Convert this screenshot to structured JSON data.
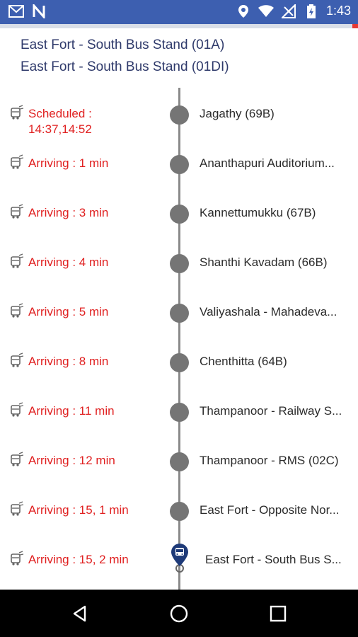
{
  "statusbar": {
    "time": "1:43",
    "colors": {
      "background": "#3d5fb0",
      "foreground": "#ffffff"
    },
    "icons": [
      "gmail-icon",
      "n-app-icon",
      "location-icon",
      "wifi-icon",
      "signal-icon",
      "battery-icon"
    ]
  },
  "header": {
    "route_line_1": "East Fort - South Bus Stand (01A)",
    "route_line_2": "East Fort - South Bus Stand (01DI)"
  },
  "stops": [
    {
      "status": "Scheduled :\n14:37,14:52",
      "name": "Jagathy (69B)"
    },
    {
      "status": "Arriving : 1 min",
      "name": "Ananthapuri Auditorium..."
    },
    {
      "status": "Arriving : 3 min",
      "name": "Kannettumukku (67B)"
    },
    {
      "status": "Arriving : 4 min",
      "name": "Shanthi Kavadam (66B)"
    },
    {
      "status": "Arriving : 5 min",
      "name": "Valiyashala - Mahadeva..."
    },
    {
      "status": "Arriving : 8 min",
      "name": "Chenthitta (64B)"
    },
    {
      "status": "Arriving : 11 min",
      "name": "Thampanoor - Railway S..."
    },
    {
      "status": "Arriving : 12 min",
      "name": "Thampanoor - RMS (02C)"
    },
    {
      "status": "Arriving : 15, 1 min",
      "name": "East Fort - Opposite Nor..."
    },
    {
      "status": "Arriving : 15, 2 min",
      "name": "East Fort - South Bus S..."
    }
  ],
  "colors": {
    "status_text": "#e02020",
    "stop_text": "#2b2b2b",
    "timeline": "#8a8a8a",
    "dot": "#757575",
    "marker": "#1e3a78"
  },
  "navbar": {
    "icons": [
      "back-icon",
      "home-icon",
      "recents-icon"
    ]
  }
}
